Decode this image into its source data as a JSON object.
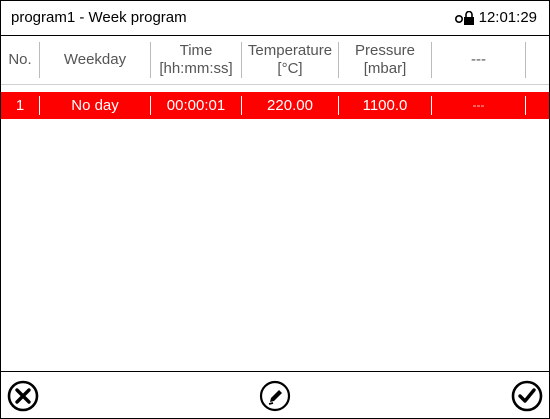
{
  "titlebar": {
    "title": "program1 - Week program",
    "time": "12:01:29",
    "lock_icon": "lock-icon"
  },
  "table": {
    "columns": [
      {
        "line1": "No.",
        "line2": ""
      },
      {
        "line1": "Weekday",
        "line2": ""
      },
      {
        "line1": "Time",
        "line2": "[hh:mm:ss]"
      },
      {
        "line1": "Temperature",
        "line2": "[°C]"
      },
      {
        "line1": "Pressure",
        "line2": "[mbar]"
      },
      {
        "line1": "---",
        "line2": ""
      }
    ],
    "rows": [
      {
        "no": "1",
        "weekday": "No day",
        "time": "00:00:01",
        "temperature": "220.00",
        "pressure": "1100.0",
        "extra": "---"
      }
    ],
    "selected_color": "#ff0000"
  },
  "footer": {
    "cancel_icon": "close-circle-icon",
    "edit_icon": "pencil-icon",
    "confirm_icon": "checkmark-icon"
  }
}
